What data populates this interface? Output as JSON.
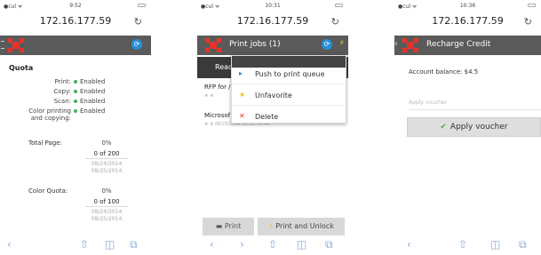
{
  "phone1": {
    "status": {
      "carrier": "●cul ᯤ",
      "time": "9:52"
    },
    "url": "172.16.177.59",
    "quota_title": "Quota",
    "features": [
      {
        "label": "Print:",
        "value": "Enabled"
      },
      {
        "label": "Copy:",
        "value": "Enabled"
      },
      {
        "label": "Scan:",
        "value": "Enabled"
      },
      {
        "label": "Color printing and copying:",
        "value": "Enabled"
      }
    ],
    "total_page": {
      "label": "Total Page:",
      "percent": "0%",
      "count": "0 of 200",
      "date_from": "08/24/2014",
      "date_to": "08/25/2014"
    },
    "color_quota": {
      "label": "Color Quota:",
      "percent": "0%",
      "count": "0 of 100",
      "date_from": "08/24/2014",
      "date_to": "08/25/2014"
    }
  },
  "phone2": {
    "status": {
      "carrier": "●cul ᯤ",
      "time": "10:31"
    },
    "url": "172.16.177.59",
    "title": "Print jobs (1)",
    "filter_label": "Ready",
    "jobs": [
      {
        "name": "RFP for /",
        "meta": ""
      },
      {
        "name": "Microsof",
        "meta": "08/25/2014 10:26:34 AM"
      }
    ],
    "menu": [
      {
        "label": "Push to print queue"
      },
      {
        "label": "Unfavorite"
      },
      {
        "label": "Delete"
      }
    ],
    "print_label": "Print",
    "print_unlock_label": "Print and Unlock"
  },
  "phone3": {
    "status": {
      "carrier": "●cul ᯤ",
      "time": "10:36"
    },
    "url": "172.16.177.59",
    "title": "Recharge Credit",
    "balance": "Account balance: $4.5",
    "voucher_placeholder": "Apply voucher",
    "apply_label": "Apply voucher"
  },
  "colors": {
    "appbar": "#5a5a5a",
    "accent_red": "#e6332a",
    "enabled_green": "#3fb34f",
    "sync_blue": "#2a8fd6"
  }
}
